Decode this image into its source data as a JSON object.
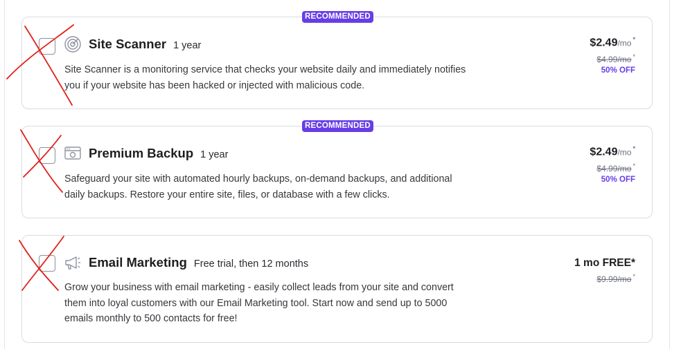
{
  "offers": [
    {
      "badge": "RECOMMENDED",
      "icon": "radar-icon",
      "title": "Site Scanner",
      "period": "1 year",
      "description": "Site Scanner is a monitoring service that checks your website daily and immediately notifies you if your website has been hacked or injected with malicious code.",
      "price": "$2.49",
      "price_unit": "/mo",
      "asterisk": "*",
      "old_price": "$4.99/mo",
      "discount": "50% OFF",
      "crossed_out": true
    },
    {
      "badge": "RECOMMENDED",
      "icon": "backup-icon",
      "title": "Premium Backup",
      "period": "1 year",
      "description": "Safeguard your site with automated hourly backups, on-demand backups, and additional daily backups. Restore your entire site, files, or database with a few clicks.",
      "price": "$2.49",
      "price_unit": "/mo",
      "asterisk": "*",
      "old_price": "$4.99/mo",
      "discount": "50% OFF",
      "crossed_out": true
    },
    {
      "icon": "megaphone-icon",
      "title": "Email Marketing",
      "period": "Free trial, then 12 months",
      "description": "Grow your business with email marketing - easily collect leads from your site and convert them into loyal customers with our Email Marketing tool. Start now and send up to 5000 emails monthly to 500 contacts for free!",
      "price": "1 mo FREE",
      "asterisk": "*",
      "old_price": "$9.99/mo",
      "crossed_out": true
    }
  ],
  "colors": {
    "accent": "#673de6",
    "annotation": "#e0211b",
    "border": "#d9dbe0"
  }
}
